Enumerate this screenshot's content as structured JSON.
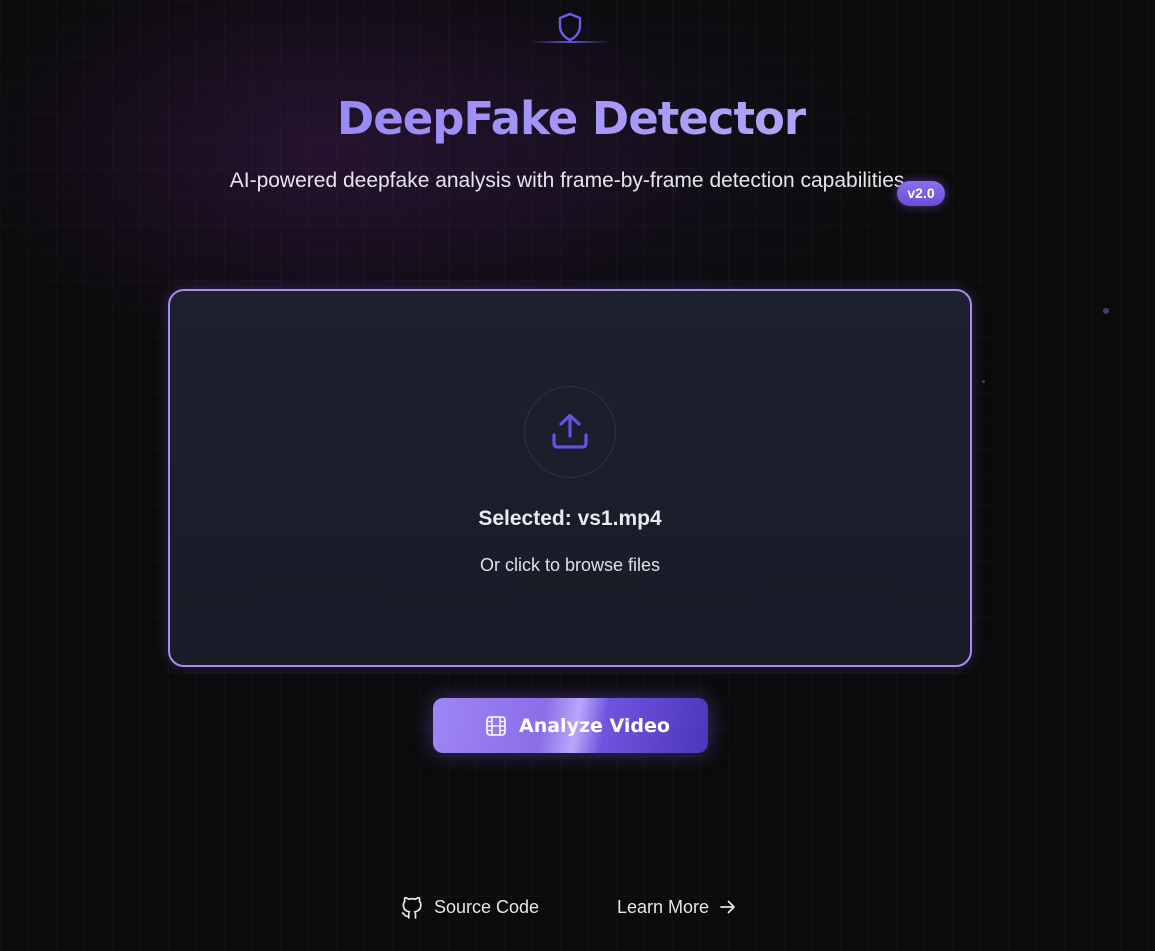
{
  "header": {
    "logo_icon": "shield-icon",
    "title": "DeepFake Detector",
    "subtitle": "AI-powered deepfake analysis with frame-by-frame detection capabilities.",
    "version_badge": "v2.0"
  },
  "upload": {
    "icon": "upload-icon",
    "selected_text": "Selected: vs1.mp4",
    "browse_text": "Or click to browse files"
  },
  "actions": {
    "analyze_icon": "film-icon",
    "analyze_label": "Analyze Video"
  },
  "footer": {
    "source_icon": "github-icon",
    "source_label": "Source Code",
    "learn_label": "Learn More",
    "learn_icon": "arrow-right-icon"
  },
  "colors": {
    "accent": "#8b7cf0",
    "border": "#a98af5",
    "background": "#0b0b0c",
    "card": "#1b1f2c"
  }
}
